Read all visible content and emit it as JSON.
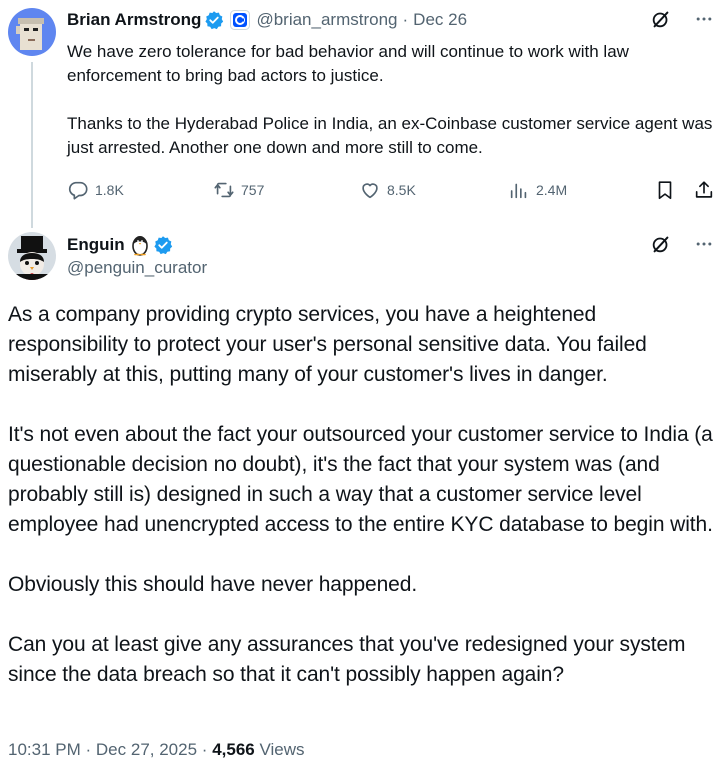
{
  "parent_tweet": {
    "author_name": "Brian Armstrong",
    "handle": "@brian_armstrong",
    "separator": "·",
    "date": "Dec 26",
    "paragraphs": [
      "We have zero tolerance for bad behavior and will continue to work with law enforcement to bring bad actors to justice.",
      "Thanks to the Hyderabad Police in India, an ex-Coinbase customer service agent was just arrested. Another one down and more still to come."
    ],
    "replies": "1.8K",
    "reposts": "757",
    "likes": "8.5K",
    "views": "2.4M"
  },
  "reply_tweet": {
    "author_name": "Enguin",
    "handle": "@penguin_curator",
    "paragraphs": [
      "As a company providing crypto services, you have a heightened responsibility to protect your user's personal sensitive data. You failed miserably at this, putting many of your customer's lives in danger.",
      "It's not even about the fact your outsourced your customer service to India (a questionable decision no doubt), it's the fact that your system was (and probably still is) designed in such a way that a customer service level employee had unencrypted access to the entire KYC database to begin with.",
      "Obviously this should have never happened.",
      "Can you at least give any assurances that you've redesigned your system since the data breach so that it can't possibly happen again?"
    ],
    "time": "10:31 PM",
    "separator": "·",
    "date": "Dec 27, 2025",
    "views_count": "4,566",
    "views_label": "Views"
  },
  "icons": {
    "verified": "verified-badge-icon",
    "org_badge": "coinbase-badge-icon",
    "grok": "grok-icon",
    "more": "more-icon",
    "reply": "reply-icon",
    "repost": "repost-icon",
    "like": "like-icon",
    "views": "views-icon",
    "bookmark": "bookmark-icon",
    "share": "share-icon"
  },
  "colors": {
    "text": "#0f1419",
    "secondary": "#536471",
    "verified_blue": "#1d9bf0",
    "thread_line": "#cfd9de",
    "coinbase_blue": "#0052ff"
  }
}
